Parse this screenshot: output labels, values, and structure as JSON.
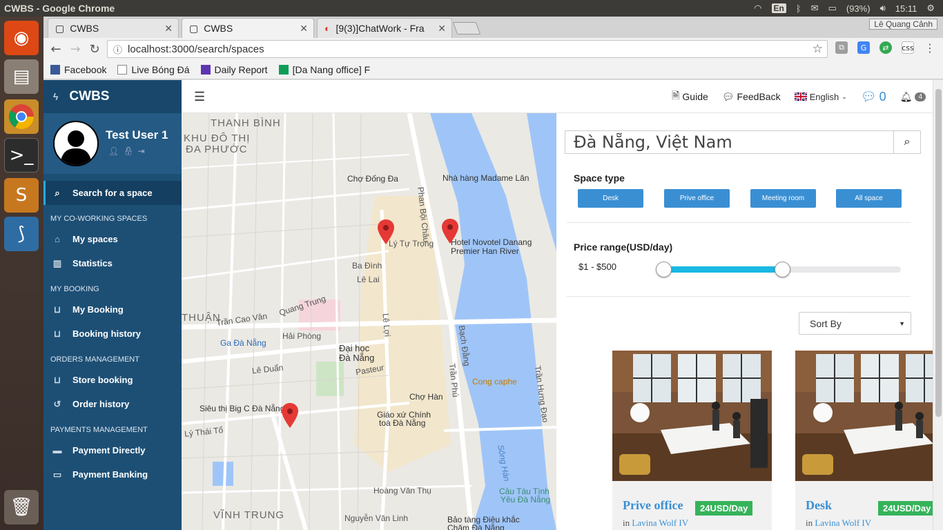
{
  "os": {
    "window_title": "CWBS - Google Chrome",
    "lang": "En",
    "battery": "(93%)",
    "time": "15:11"
  },
  "browser": {
    "tabs": [
      {
        "label": "CWBS"
      },
      {
        "label": "CWBS"
      },
      {
        "label": "[9(3)]ChatWork - Fra"
      }
    ],
    "profile": "Lê Quang Cảnh",
    "url": "localhost:3000/search/spaces",
    "bookmarks": [
      {
        "label": "Facebook",
        "color": "#3b5998"
      },
      {
        "label": "Live Bóng Đá",
        "color": "#888888"
      },
      {
        "label": "Daily Report",
        "color": "#5e35b1"
      },
      {
        "label": "[Da Nang office] F",
        "color": "#0f9d58"
      }
    ]
  },
  "sidebar": {
    "brand": "CWBS",
    "user_name": "Test User 1",
    "search_item": "Search for a space",
    "sections": [
      {
        "header": "MY CO-WORKING SPACES",
        "items": [
          "My spaces",
          "Statistics"
        ]
      },
      {
        "header": "MY BOOKING",
        "items": [
          "My Booking",
          "Booking history"
        ]
      },
      {
        "header": "ORDERS MANAGEMENT",
        "items": [
          "Store booking",
          "Order history"
        ]
      },
      {
        "header": "PAYMENTS MANAGEMENT",
        "items": [
          "Payment Directly",
          "Payment Banking"
        ]
      }
    ]
  },
  "topnav": {
    "guide": "Guide",
    "feedback": "FeedBack",
    "language": "English",
    "chat_count": "0",
    "notif_count": "4"
  },
  "map": {
    "labels": [
      "THANH BÌNH",
      "KHU ĐÔ THỊ",
      "ĐA PHƯỚC",
      "Chợ Đống Đa",
      "Nhà hàng Madame Lân",
      "Hotel Novotel Danang",
      "Premier Han River",
      "Lý Tự Trọng",
      "Ba Đình",
      "Lê Lai",
      "Quang Trung",
      "THUẬN",
      "Trần Cao Vân",
      "Ga Đà Nẵng",
      "Hải Phòng",
      "Đại học",
      "Đà Nẵng",
      "Pasteur",
      "Lê Duẩn",
      "Cong caphe",
      "Chợ Hàn",
      "Siêu thị Big C Đà Nẵng",
      "Giáo xứ Chính",
      "toà Đà Nẵng",
      "Lý Thái Tổ",
      "Sông Hàn",
      "Hoàng Văn Thụ",
      "Cầu Tàu Tình",
      "Yêu Đà Nẵng",
      "VĨNH TRUNG",
      "Nguyễn Văn Linh",
      "Bảo tàng Điêu khắc",
      "Chăm Đà Nẵng",
      "Bạch Đằng",
      "Trần Hưng Đạo",
      "Lê Lợi",
      "Trần Phú",
      "Phan Bội Châu"
    ]
  },
  "filters": {
    "search_value": "Đà Nẵng, Việt Nam",
    "space_type_title": "Space type",
    "types": [
      "Desk",
      "Prive office",
      "Meeting room",
      "All space"
    ],
    "price_title": "Price range(USD/day)",
    "price_text": "$1 - $500",
    "price_range": {
      "min": 0,
      "max": 500,
      "low": 1,
      "high": 500,
      "low_pct": 0,
      "high_pct": 0.5
    },
    "sort_label": "Sort By"
  },
  "cards": [
    {
      "title": "Prive office",
      "price": "24USD/Day",
      "loc_prefix": "in",
      "location": "Lavina Wolf IV"
    },
    {
      "title": "Desk",
      "price": "24USD/Day",
      "loc_prefix": "in",
      "location": "Lavina Wolf IV"
    }
  ]
}
